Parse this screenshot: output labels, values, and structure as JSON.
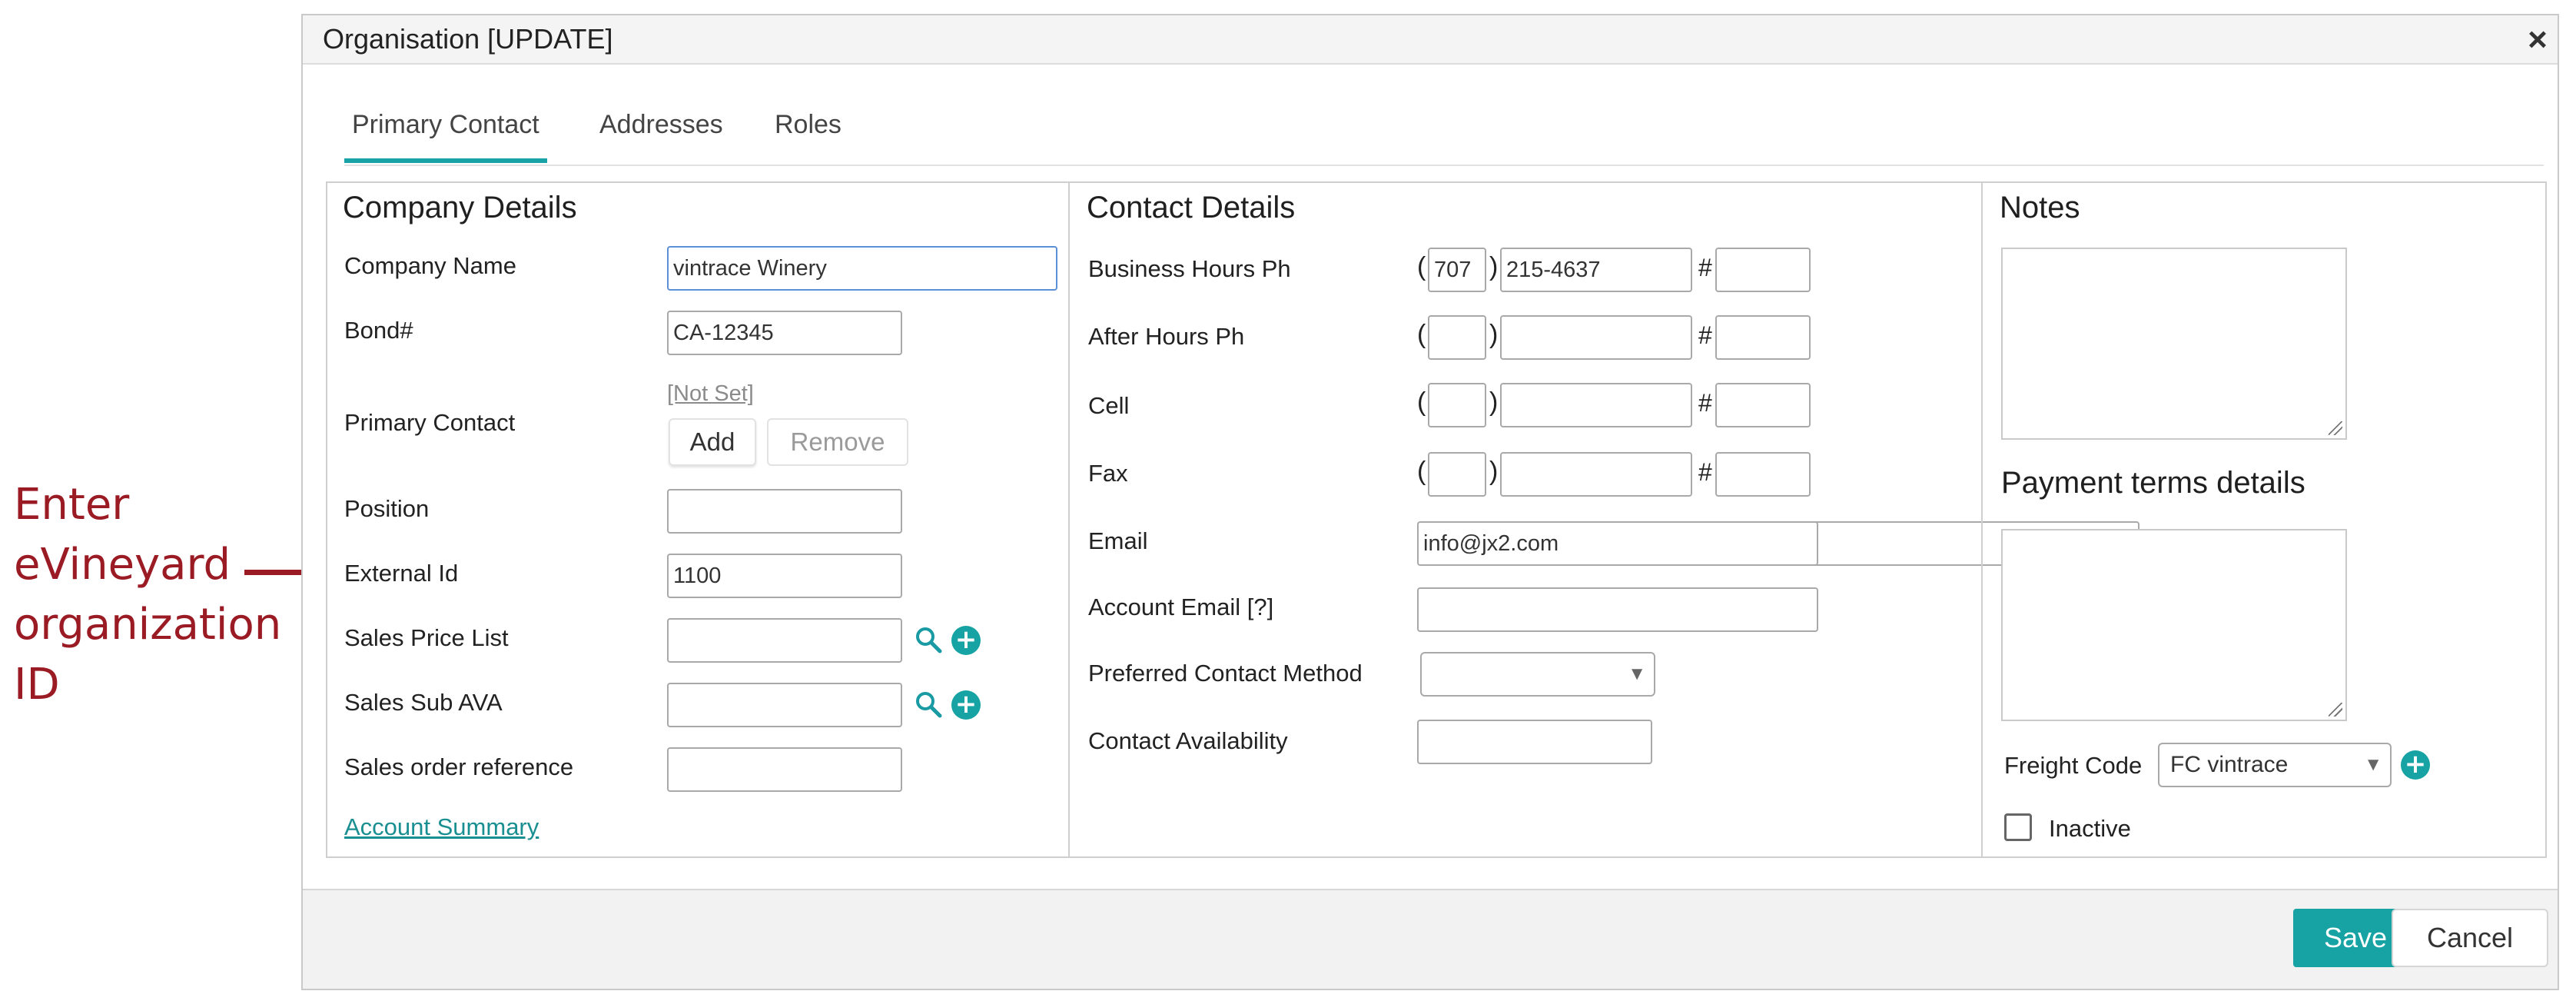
{
  "annotation": {
    "lines": [
      "Enter",
      "eVineyard",
      "organization",
      "ID"
    ]
  },
  "dialog": {
    "title": "Organisation [UPDATE]",
    "close_symbol": "×",
    "tabs": [
      {
        "label": "Primary Contact",
        "active": true
      },
      {
        "label": "Addresses",
        "active": false
      },
      {
        "label": "Roles",
        "active": false
      }
    ],
    "company": {
      "section_title": "Company Details",
      "company_name_label": "Company Name",
      "company_name_value": "vintrace Winery",
      "bond_label": "Bond#",
      "bond_value": "CA-12345",
      "primary_contact_label": "Primary Contact",
      "primary_contact_value": "[Not Set]",
      "add_label": "Add",
      "remove_label": "Remove",
      "position_label": "Position",
      "position_value": "",
      "external_id_label": "External Id",
      "external_id_value": "1100",
      "sales_price_list_label": "Sales Price List",
      "sales_price_list_value": "",
      "sales_sub_ava_label": "Sales Sub AVA",
      "sales_sub_ava_value": "",
      "sales_order_ref_label": "Sales order reference",
      "sales_order_ref_value": "",
      "account_summary_link": "Account Summary"
    },
    "contact": {
      "section_title": "Contact Details",
      "paren_open": "(",
      "paren_close": ")",
      "hash": "#",
      "business_label": "Business Hours Ph",
      "business_area": "707",
      "business_number": "215-4637",
      "business_ext": "",
      "after_label": "After Hours Ph",
      "cell_label": "Cell",
      "fax_label": "Fax",
      "email_label": "Email",
      "email_value": "info@jx2.com",
      "account_email_label": "Account Email [?]",
      "account_email_value": "",
      "preferred_method_label": "Preferred Contact Method",
      "preferred_method_value": "",
      "availability_label": "Contact Availability",
      "availability_value": ""
    },
    "notes": {
      "notes_title": "Notes",
      "payment_terms_title": "Payment terms details",
      "freight_code_label": "Freight Code",
      "freight_code_value": "FC vintrace",
      "inactive_label": "Inactive",
      "inactive_checked": false
    },
    "footer": {
      "save_label": "Save",
      "cancel_label": "Cancel"
    }
  },
  "icons": {
    "search": "search-icon",
    "add": "plus-circle-icon",
    "dropdown": "chevron-down-icon",
    "close": "close-icon"
  },
  "colors": {
    "accent": "#17a3a3",
    "annotation": "#9b1b24",
    "focus_border": "#5b8fd6"
  }
}
